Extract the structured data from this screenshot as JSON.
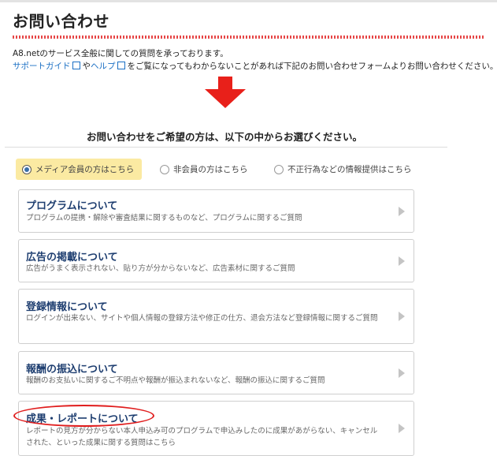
{
  "page": {
    "title": "お問い合わせ",
    "intro_line1": "A8.netのサービス全般に関しての質問を承っております。",
    "support_guide_link": "サポートガイド",
    "connector1": "や",
    "help_link": "ヘルプ",
    "intro_line2_rest": "をご覧になってもわからないことがあれば下記のお問い合わせフォームよりお問い合わせください。",
    "choose_heading": "お問い合わせをご希望の方は、以下の中からお選びください。"
  },
  "radios": [
    {
      "label": "メディア会員の方はこちら",
      "checked": true
    },
    {
      "label": "非会員の方はこちら",
      "checked": false
    },
    {
      "label": "不正行為などの情報提供はこちら",
      "checked": false
    }
  ],
  "cards": [
    {
      "title": "プログラムについて",
      "desc": "プログラムの提携・解除や審査結果に関するものなど、プログラムに関するご質問"
    },
    {
      "title": "広告の掲載について",
      "desc": "広告がうまく表示されない、貼り方が分からないなど、広告素材に関するご質問"
    },
    {
      "title": "登録情報について",
      "desc": "ログインが出来ない、サイトや個人情報の登録方法や修正の仕方、退会方法など登録情報に関するご質問"
    },
    {
      "title": "報酬の振込について",
      "desc": "報酬のお支払いに関するご不明点や報酬が振込まれないなど、報酬の振込に関するご質問"
    },
    {
      "title": "成果・レポートについて",
      "desc": "レポートの見方が分からない本人申込み可のプログラムで申込みしたのに成果があがらない、キャンセルされた、といった成果に関する質問はこちら"
    }
  ],
  "colors": {
    "title_rule": "#e64747",
    "link": "#1a6fc4",
    "arrow": "#e8201a",
    "selected_bg": "#fbeaa2",
    "card_title": "#1e3e70",
    "highlight_ellipse": "#e01d1d"
  },
  "icons": {
    "external_link": "external-link-icon",
    "down_arrow": "down-arrow-icon",
    "card_chevron": "chevron-right-icon"
  }
}
